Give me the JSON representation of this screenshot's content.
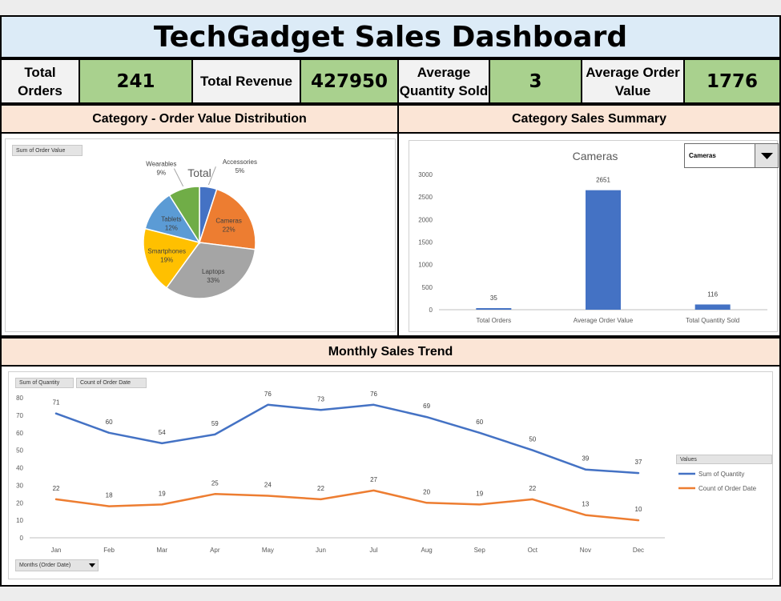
{
  "dashboard": {
    "title": "TechGadget Sales Dashboard",
    "kpis": [
      {
        "label": "Total Orders",
        "value": "241"
      },
      {
        "label": "Total Revenue",
        "value": "427950"
      },
      {
        "label": "Average Quantity Sold",
        "value": "3"
      },
      {
        "label": "Average Order Value",
        "value": "1776"
      }
    ],
    "sections": {
      "pie": "Category - Order Value Distribution",
      "bar": "Category Sales Summary",
      "line": "Monthly Sales Trend"
    },
    "pie_field_button": "Sum of Order Value",
    "line_field_buttons": [
      "Sum of Quantity",
      "Count of Order Date"
    ],
    "line_axis_button": "Months (Order Date)",
    "legend_field_button": "Values",
    "category_dropdown": {
      "selected": "Cameras"
    }
  },
  "colors": {
    "blue": "#4472c4",
    "orange": "#ed7d31",
    "gray": "#a5a5a5",
    "gold": "#ffc000",
    "light_blue": "#5b9bd5",
    "green": "#70ad47"
  },
  "chart_data": [
    {
      "type": "pie",
      "title": "Total",
      "series": [
        {
          "name": "Total",
          "values": [
            5,
            22,
            33,
            19,
            12,
            9
          ]
        }
      ],
      "categories": [
        "Accessories",
        "Cameras",
        "Laptops",
        "Smartphones",
        "Tablets",
        "Wearables"
      ],
      "labels": [
        "5%",
        "22%",
        "33%",
        "19%",
        "12%",
        "9%"
      ],
      "colors": [
        "#4472c4",
        "#ed7d31",
        "#a5a5a5",
        "#ffc000",
        "#5b9bd5",
        "#70ad47"
      ]
    },
    {
      "type": "bar",
      "title": "Cameras",
      "categories": [
        "Total Orders",
        "Average Order Value",
        "Total Quantity Sold"
      ],
      "values": [
        35,
        2651,
        116
      ],
      "ylim": [
        0,
        3000
      ],
      "yticks": [
        0,
        500,
        1000,
        1500,
        2000,
        2500,
        3000
      ],
      "grid": false,
      "color": "#4472c4"
    },
    {
      "type": "line",
      "x": [
        "Jan",
        "Feb",
        "Mar",
        "Apr",
        "May",
        "Jun",
        "Jul",
        "Aug",
        "Sep",
        "Oct",
        "Nov",
        "Dec"
      ],
      "series": [
        {
          "name": "Sum of Quantity",
          "values": [
            71,
            60,
            54,
            59,
            76,
            73,
            76,
            69,
            60,
            50,
            39,
            37
          ],
          "color": "#4472c4"
        },
        {
          "name": "Count of Order Date",
          "values": [
            22,
            18,
            19,
            25,
            24,
            22,
            27,
            20,
            19,
            22,
            13,
            10
          ],
          "color": "#ed7d31"
        }
      ],
      "ylim": [
        0,
        80
      ],
      "yticks": [
        0,
        10,
        20,
        30,
        40,
        50,
        60,
        70,
        80
      ],
      "legend": "right",
      "grid": false
    }
  ]
}
